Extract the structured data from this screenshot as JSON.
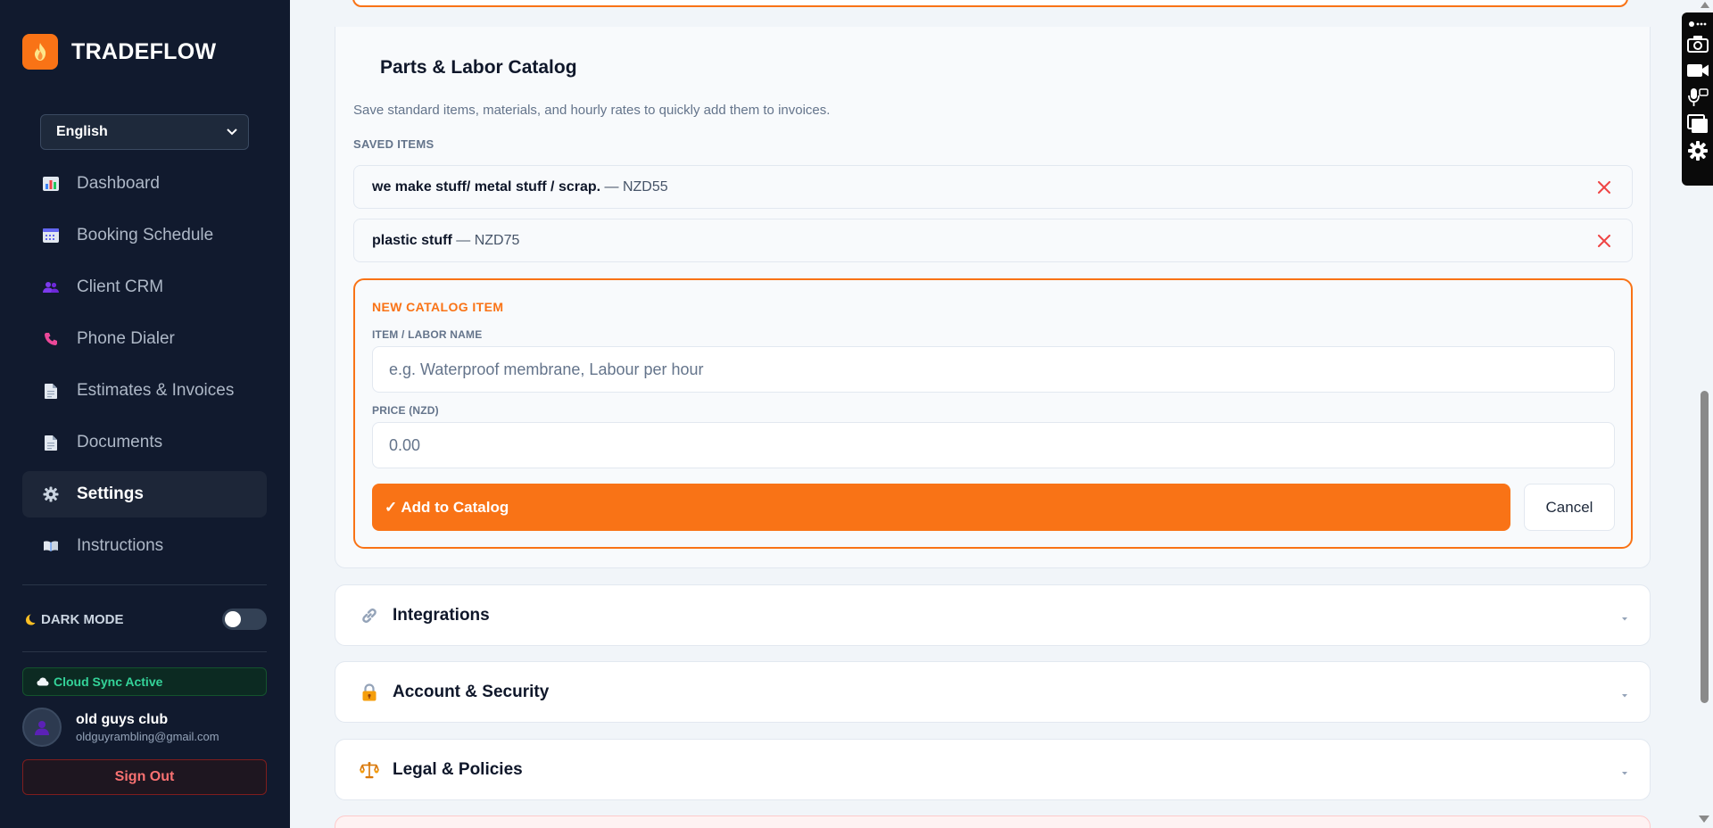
{
  "brand": {
    "name": "TRADEFLOW"
  },
  "language": {
    "selected": "English"
  },
  "nav": [
    {
      "label": "Dashboard",
      "icon": "chart-icon"
    },
    {
      "label": "Booking Schedule",
      "icon": "calendar-icon"
    },
    {
      "label": "Client CRM",
      "icon": "users-icon"
    },
    {
      "label": "Phone Dialer",
      "icon": "phone-icon"
    },
    {
      "label": "Estimates & Invoices",
      "icon": "document-icon"
    },
    {
      "label": "Documents",
      "icon": "document-icon"
    },
    {
      "label": "Settings",
      "icon": "gear-icon",
      "active": true
    },
    {
      "label": "Instructions",
      "icon": "book-icon"
    }
  ],
  "dark_mode": {
    "label": "DARK MODE",
    "enabled": false
  },
  "sync": {
    "label": "Cloud Sync Active"
  },
  "user": {
    "name": "old guys club",
    "email": "oldguyrambling@gmail.com"
  },
  "sign_out": "Sign Out",
  "catalog": {
    "title": "Parts & Labor Catalog",
    "description": "Save standard items, materials, and hourly rates to quickly add them to invoices.",
    "saved_label": "SAVED ITEMS",
    "items": [
      {
        "name": "we make stuff/ metal stuff / scrap.",
        "price": " — NZD55"
      },
      {
        "name": "plastic stuff",
        "price": " — NZD75"
      }
    ],
    "new_item": {
      "heading": "NEW CATALOG ITEM",
      "name_label": "ITEM / LABOR NAME",
      "name_placeholder": "e.g. Waterproof membrane, Labour per hour",
      "price_label": "PRICE (NZD)",
      "price_placeholder": "0.00",
      "add_button": "✓ Add to Catalog",
      "cancel_button": "Cancel"
    }
  },
  "sections": [
    {
      "title": "Integrations",
      "icon": "link-icon"
    },
    {
      "title": "Account & Security",
      "icon": "lock-icon"
    },
    {
      "title": "Legal & Policies",
      "icon": "scales-icon"
    }
  ],
  "colors": {
    "accent": "#f97316",
    "sidebar_bg": "#111a2e",
    "danger": "#ef4444",
    "success": "#34d399"
  }
}
